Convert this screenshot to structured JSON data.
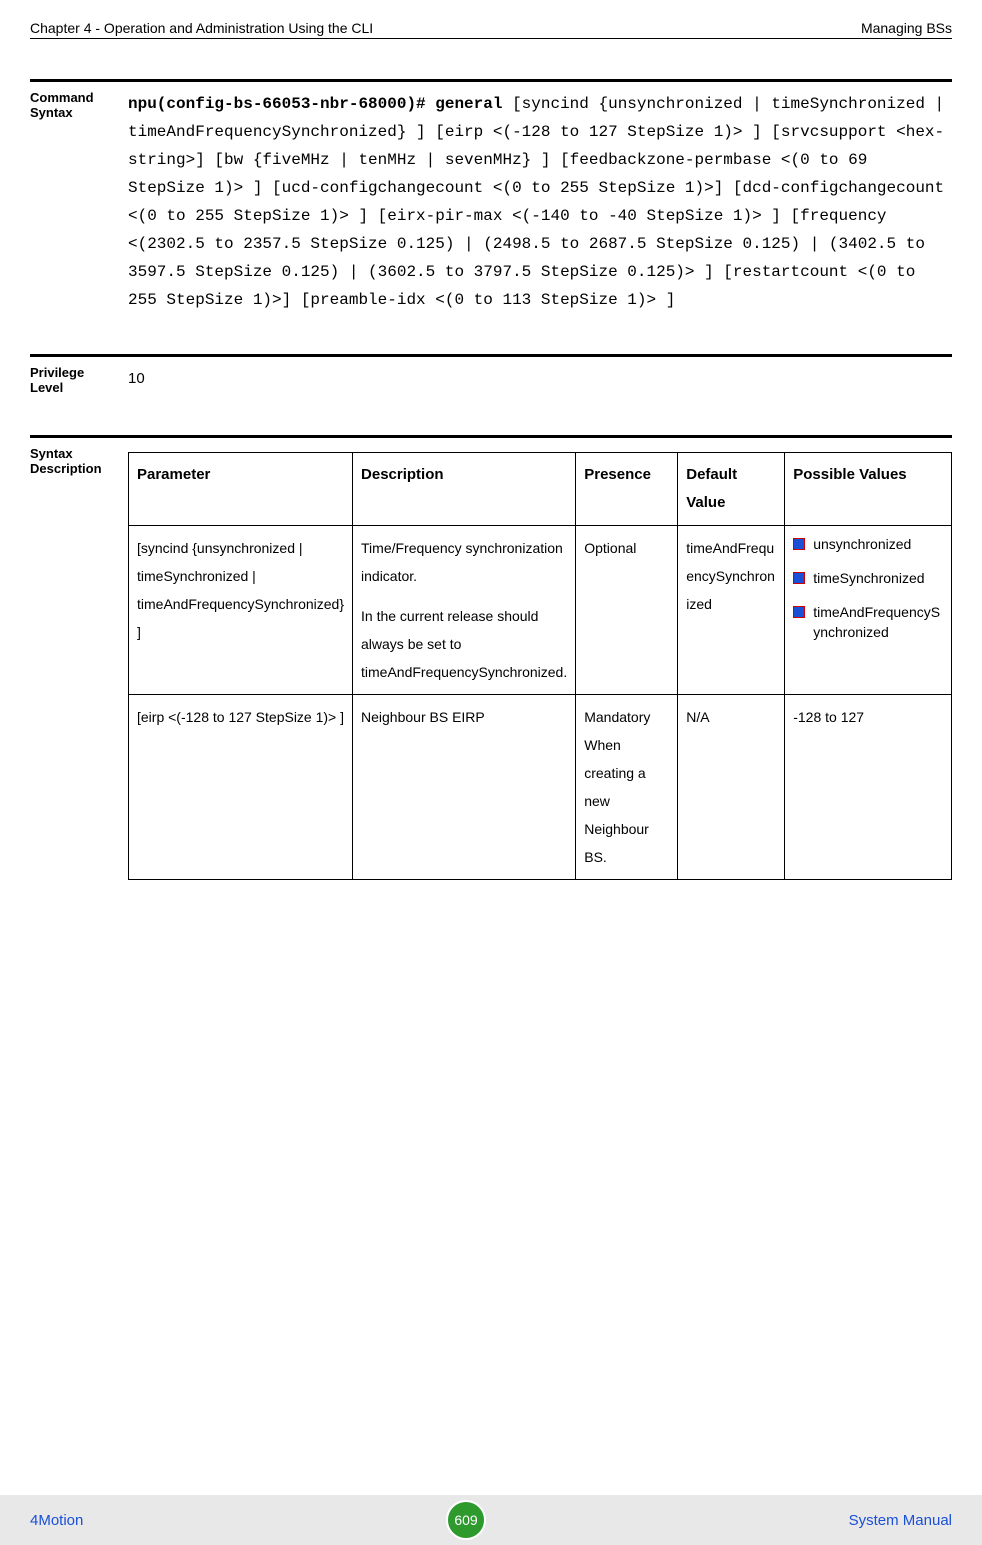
{
  "header": {
    "left": "Chapter 4 - Operation and Administration Using the CLI",
    "right": "Managing BSs"
  },
  "command": {
    "label": "Command Syntax",
    "prefix": "npu(config-bs-66053-nbr-68000)# general",
    "rest": " [syncind {unsynchronized | timeSynchronized | timeAndFrequencySynchronized} ] [eirp <(-128 to 127 StepSize 1)> ] [srvcsupport <hex-string>] [bw {fiveMHz | tenMHz | sevenMHz} ] [feedbackzone-permbase <(0 to 69 StepSize 1)> ] [ucd-configchangecount <(0 to 255 StepSize 1)>] [dcd-configchangecount <(0 to 255 StepSize 1)> ] [eirx-pir-max <(-140 to -40 StepSize 1)> ] [frequency <(2302.5 to 2357.5 StepSize 0.125) | (2498.5 to 2687.5 StepSize 0.125) | (3402.5 to 3597.5 StepSize 0.125) | (3602.5 to 3797.5 StepSize 0.125)> ] [restartcount <(0 to 255 StepSize 1)>] [preamble-idx <(0 to 113 StepSize 1)> ]"
  },
  "privilege": {
    "label": "Privilege Level",
    "value": "10"
  },
  "syntax": {
    "label": "Syntax Description",
    "columns": {
      "c0": "Parameter",
      "c1": "Description",
      "c2": "Presence",
      "c3": "Default Value",
      "c4": "Possible Values"
    },
    "rows": [
      {
        "param": "[syncind {unsynchronized | timeSynchronized | timeAndFrequencySynchronized} ]",
        "desc1": "Time/Frequency synchronization indicator.",
        "desc2": "In the current release should always be set to timeAndFrequencySynchronized.",
        "presence": "Optional",
        "default": "timeAndFrequencySynchronized",
        "pv0": "unsynchronized",
        "pv1": "timeSynchronized",
        "pv2": "timeAndFrequencySynchronized"
      },
      {
        "param": "[eirp <(-128 to 127 StepSize 1)> ]",
        "desc1": "Neighbour BS EIRP",
        "presence": "Mandatory When creating a new Neighbour BS.",
        "default": "N/A",
        "pv": "-128 to 127"
      }
    ]
  },
  "footer": {
    "left": "4Motion",
    "page": "609",
    "right": "System Manual"
  }
}
